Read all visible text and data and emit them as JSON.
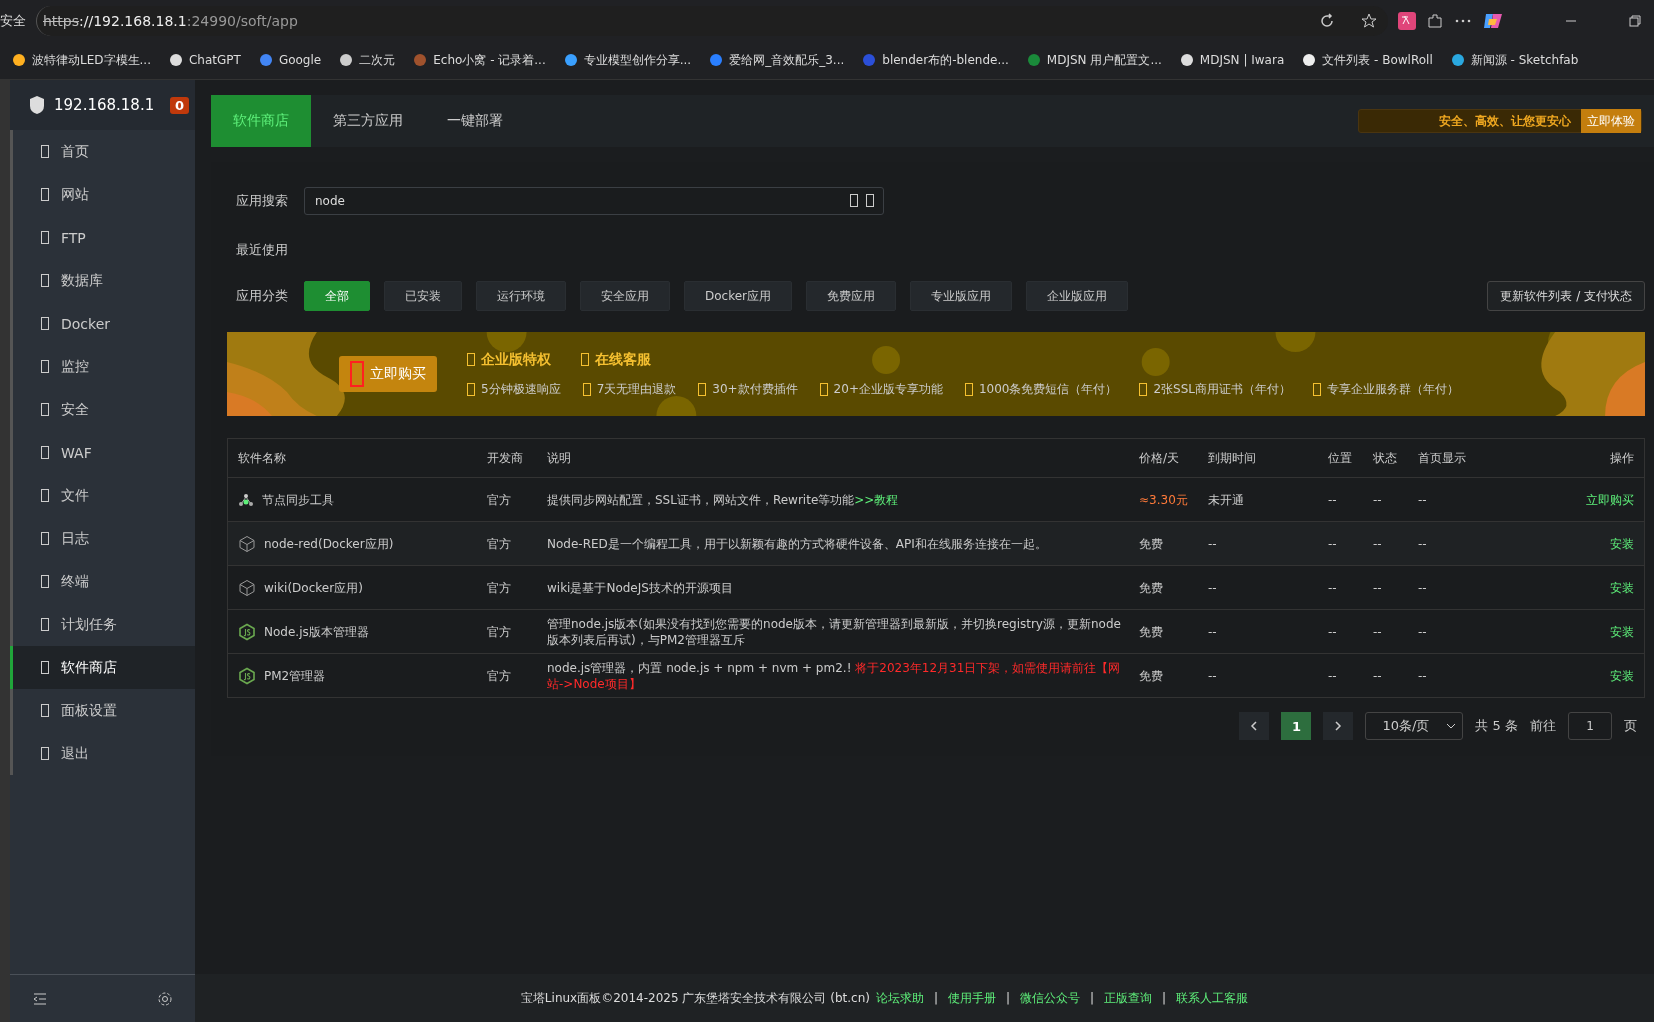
{
  "browser": {
    "security_label": "安全",
    "url_scheme": "https",
    "url_host": "://192.168.18.1",
    "url_rest": ":24990/soft/app"
  },
  "bookmarks": [
    {
      "label": "波特律动LED字模生..."
    },
    {
      "label": "ChatGPT"
    },
    {
      "label": "Google"
    },
    {
      "label": "二次元"
    },
    {
      "label": "Echo小窝 - 记录着..."
    },
    {
      "label": "专业模型创作分享..."
    },
    {
      "label": "爱给网_音效配乐_3..."
    },
    {
      "label": "blender布的-blende..."
    },
    {
      "label": "MDJSN 用户配置文..."
    },
    {
      "label": "MDJSN | Iwara"
    },
    {
      "label": "文件列表 - BowlRoll"
    },
    {
      "label": "新闻源 - Sketchfab"
    }
  ],
  "sidebar": {
    "host": "192.168.18.1",
    "badge": "0",
    "items": [
      {
        "label": "首页",
        "selected": false
      },
      {
        "label": "网站",
        "selected": false
      },
      {
        "label": "FTP",
        "selected": false
      },
      {
        "label": "数据库",
        "selected": false
      },
      {
        "label": "Docker",
        "selected": false
      },
      {
        "label": "监控",
        "selected": false
      },
      {
        "label": "安全",
        "selected": false
      },
      {
        "label": "WAF",
        "selected": false
      },
      {
        "label": "文件",
        "selected": false
      },
      {
        "label": "日志",
        "selected": false
      },
      {
        "label": "终端",
        "selected": false
      },
      {
        "label": "计划任务",
        "selected": false
      },
      {
        "label": "软件商店",
        "selected": true
      },
      {
        "label": "面板设置",
        "selected": false
      },
      {
        "label": "退出",
        "selected": false
      }
    ]
  },
  "tabs": [
    {
      "label": "软件商店",
      "selected": true
    },
    {
      "label": "第三方应用",
      "selected": false
    },
    {
      "label": "一键部署",
      "selected": false
    }
  ],
  "promo": {
    "text": "安全、高效、让您更安心",
    "button": "立即体验"
  },
  "search": {
    "label": "应用搜索",
    "value": "node"
  },
  "recent_label": "最近使用",
  "categories": {
    "label": "应用分类",
    "items": [
      {
        "label": "全部",
        "selected": true
      },
      {
        "label": "已安装",
        "selected": false
      },
      {
        "label": "运行环境",
        "selected": false
      },
      {
        "label": "安全应用",
        "selected": false
      },
      {
        "label": "Docker应用",
        "selected": false
      },
      {
        "label": "免费应用",
        "selected": false
      },
      {
        "label": "专业版应用",
        "selected": false
      },
      {
        "label": "企业版应用",
        "selected": false
      }
    ],
    "update_button": "更新软件列表 / 支付状态"
  },
  "banner": {
    "buy_button": "立即购买",
    "titles": [
      "企业版特权",
      "在线客服"
    ],
    "features": [
      "5分钟极速响应",
      "7天无理由退款",
      "30+款付费插件",
      "20+企业版专享功能",
      "1000条免费短信（年付）",
      "2张SSL商用证书（年付）",
      "专享企业服务群（年付）"
    ]
  },
  "table": {
    "columns": [
      "软件名称",
      "开发商",
      "说明",
      "价格/天",
      "到期时间",
      "位置",
      "状态",
      "首页显示",
      "操作"
    ],
    "rows": [
      {
        "name": "节点同步工具",
        "developer": "官方",
        "description": [
          {
            "kind": "normal",
            "text": "提供同步网站配置，SSL证书，网站文件，Rewrite等功能"
          },
          {
            "kind": "link",
            "text": ">>教程"
          }
        ],
        "price": {
          "text": "≈3.30元",
          "color": "#ff7a3a"
        },
        "expire": "未开通",
        "position": "--",
        "status": "--",
        "home": "--",
        "action": "立即购买"
      },
      {
        "name": "node-red(Docker应用)",
        "developer": "官方",
        "description": [
          {
            "kind": "normal",
            "text": "Node-RED是一个编程工具，用于以新颖有趣的方式将硬件设备、API和在线服务连接在一起。"
          }
        ],
        "price": {
          "text": "免费"
        },
        "expire": "--",
        "position": "--",
        "status": "--",
        "home": "--",
        "action": "安装"
      },
      {
        "name": "wiki(Docker应用)",
        "developer": "官方",
        "description": [
          {
            "kind": "normal",
            "text": "wiki是基于NodeJS技术的开源项目"
          }
        ],
        "price": {
          "text": "免费"
        },
        "expire": "--",
        "position": "--",
        "status": "--",
        "home": "--",
        "action": "安装"
      },
      {
        "name": "Node.js版本管理器",
        "developer": "官方",
        "description": [
          {
            "kind": "normal",
            "text": "管理node.js版本(如果没有找到您需要的node版本，请更新管理器到最新版，并切换registry源，更新node版本列表后再试)，与PM2管理器互斥"
          }
        ],
        "price": {
          "text": "免费"
        },
        "expire": "--",
        "position": "--",
        "status": "--",
        "home": "--",
        "action": "安装"
      },
      {
        "name": "PM2管理器",
        "developer": "官方",
        "description": [
          {
            "kind": "normal",
            "text": "node.js管理器，内置 node.js + npm + nvm + pm2.! "
          },
          {
            "kind": "warning",
            "text": "将于2023年12月31日下架，如需使用请前往【网站->Node项目】"
          }
        ],
        "price": {
          "text": "免费"
        },
        "expire": "--",
        "position": "--",
        "status": "--",
        "home": "--",
        "action": "安装"
      }
    ]
  },
  "pagination": {
    "page": "1",
    "page_size": "10条/页",
    "total": "共 5 条",
    "goto_label": "前往",
    "goto_value": "1",
    "page_suffix": "页"
  },
  "footer": {
    "copyright": "宝塔Linux面板©2014-2025 广东堡塔安全技术有限公司 (bt.cn)",
    "items": [
      {
        "kind": "link",
        "text": "论坛求助"
      },
      {
        "kind": "separator",
        "text": "|"
      },
      {
        "kind": "link",
        "text": "使用手册"
      },
      {
        "kind": "separator",
        "text": "|"
      },
      {
        "kind": "link",
        "text": "微信公众号"
      },
      {
        "kind": "separator",
        "text": "|"
      },
      {
        "kind": "link",
        "text": "正版查询"
      },
      {
        "kind": "separator",
        "text": "|"
      },
      {
        "kind": "link",
        "text": "联系人工客服"
      }
    ]
  }
}
